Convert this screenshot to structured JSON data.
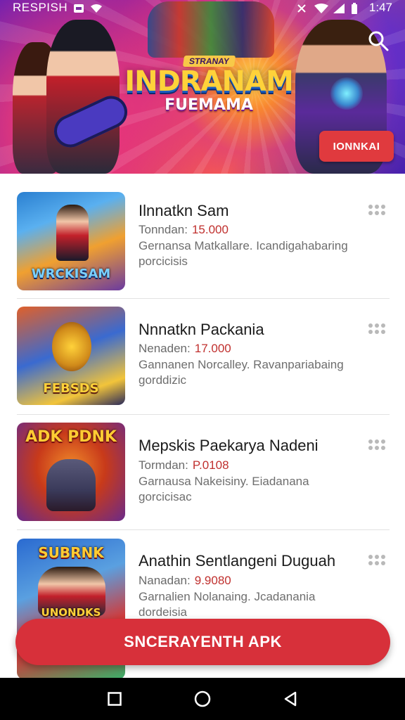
{
  "status_bar": {
    "carrier": "RESPISH",
    "time": "1:47"
  },
  "hero": {
    "logo_small": "STRANAY",
    "logo_title": "INDRANAM",
    "logo_sub": "FUEMAMA",
    "button_label": "IONNKAI",
    "search_icon": "search-icon"
  },
  "games": [
    {
      "title": "Ilnnatkn Sam",
      "meta_label": "Tonndan:",
      "meta_value": "15.000",
      "desc_line1": "Gernansa  Matkallare. Icandigahabaring",
      "desc_line2": "porcicisis",
      "thumb_label": "WRCKISAM",
      "thumb_top": "",
      "thumb_colors": [
        "#2a7fd0",
        "#f0a030",
        "#6a3aa0"
      ]
    },
    {
      "title": "Nnnatkn Packania",
      "meta_label": "Nenaden:",
      "meta_value": "17.000",
      "desc_line1": "Gannanen  Norcalley. Ravanpariabaing",
      "desc_line2": "gorddizic",
      "thumb_label": "FEBSDS",
      "thumb_top": "",
      "thumb_colors": [
        "#e0602a",
        "#3a6ad0",
        "#f2c43a"
      ]
    },
    {
      "title": "Mepskis Paekarya Nadeni",
      "meta_label": "Tormdan:",
      "meta_value": "P.0108",
      "desc_line1": "Garnausa  Nakeisiny. Eiadanana",
      "desc_line2": "gorcicisac",
      "thumb_label": "",
      "thumb_top": "ADK PDNK",
      "thumb_colors": [
        "#c83a1a",
        "#6a2a8a",
        "#f08a2a"
      ]
    },
    {
      "title": "Anathin Sentlangeni Duguah",
      "meta_label": "Nanadan:",
      "meta_value": "9.9080",
      "desc_line1": "Garnalien  Nolanaing. Jcadanania",
      "desc_line2": "dordeisia",
      "thumb_label": "UNONDKS",
      "thumb_top": "SUBRNK",
      "thumb_colors": [
        "#2a6ad0",
        "#d03a3a",
        "#3ab06a"
      ]
    }
  ],
  "cta": {
    "label": "SNCERAYENTH APK"
  },
  "navbar": {
    "items": [
      "recents-icon",
      "home-icon",
      "back-icon"
    ]
  }
}
